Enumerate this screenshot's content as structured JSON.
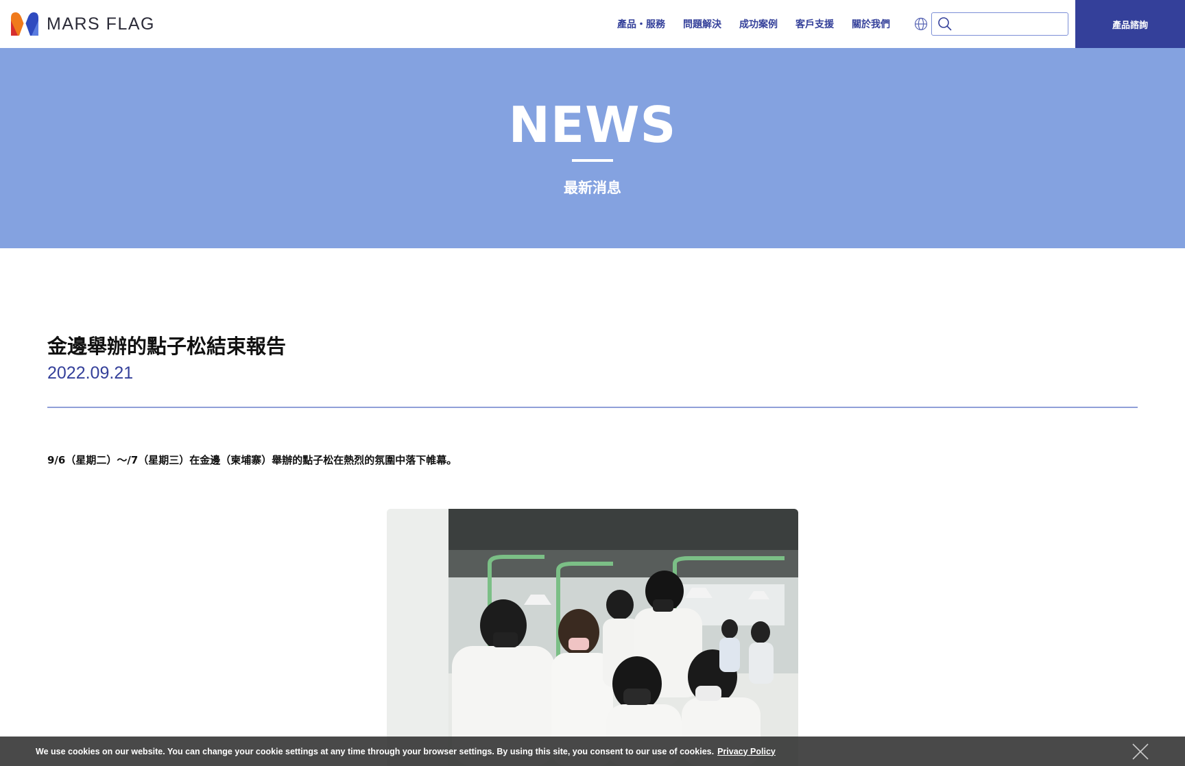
{
  "brand": {
    "name": "MARS FLAG"
  },
  "nav": {
    "items": [
      {
        "label": "產品・服務"
      },
      {
        "label": "問題解決"
      },
      {
        "label": "成功案例"
      },
      {
        "label": "客戶支援"
      },
      {
        "label": "關於我們"
      }
    ],
    "search_placeholder": "",
    "search_value": "",
    "cta_label": "產品諮詢"
  },
  "hero": {
    "title": "NEWS",
    "subtitle": "最新消息"
  },
  "article": {
    "title": "金邊舉辦的點子松結束報告",
    "date": "2022.09.21",
    "body": "9/6（星期二）～/7（星期三）在金邊（柬埔寨）舉辦的點子松在熱烈的氛圍中落下帷幕。"
  },
  "cookie": {
    "text": "We use cookies on our website. You can change your cookie settings at any time through your browser settings. By using this site, you consent to our use of cookies.",
    "link_label": "Privacy Policy"
  },
  "colors": {
    "accent": "#34409a",
    "hero_bg": "#84a2e0",
    "divider": "#8f9fd8",
    "cookie_bg": "#303030"
  },
  "icons": [
    "logo-m-icon",
    "globe-icon",
    "search-icon",
    "close-icon"
  ]
}
